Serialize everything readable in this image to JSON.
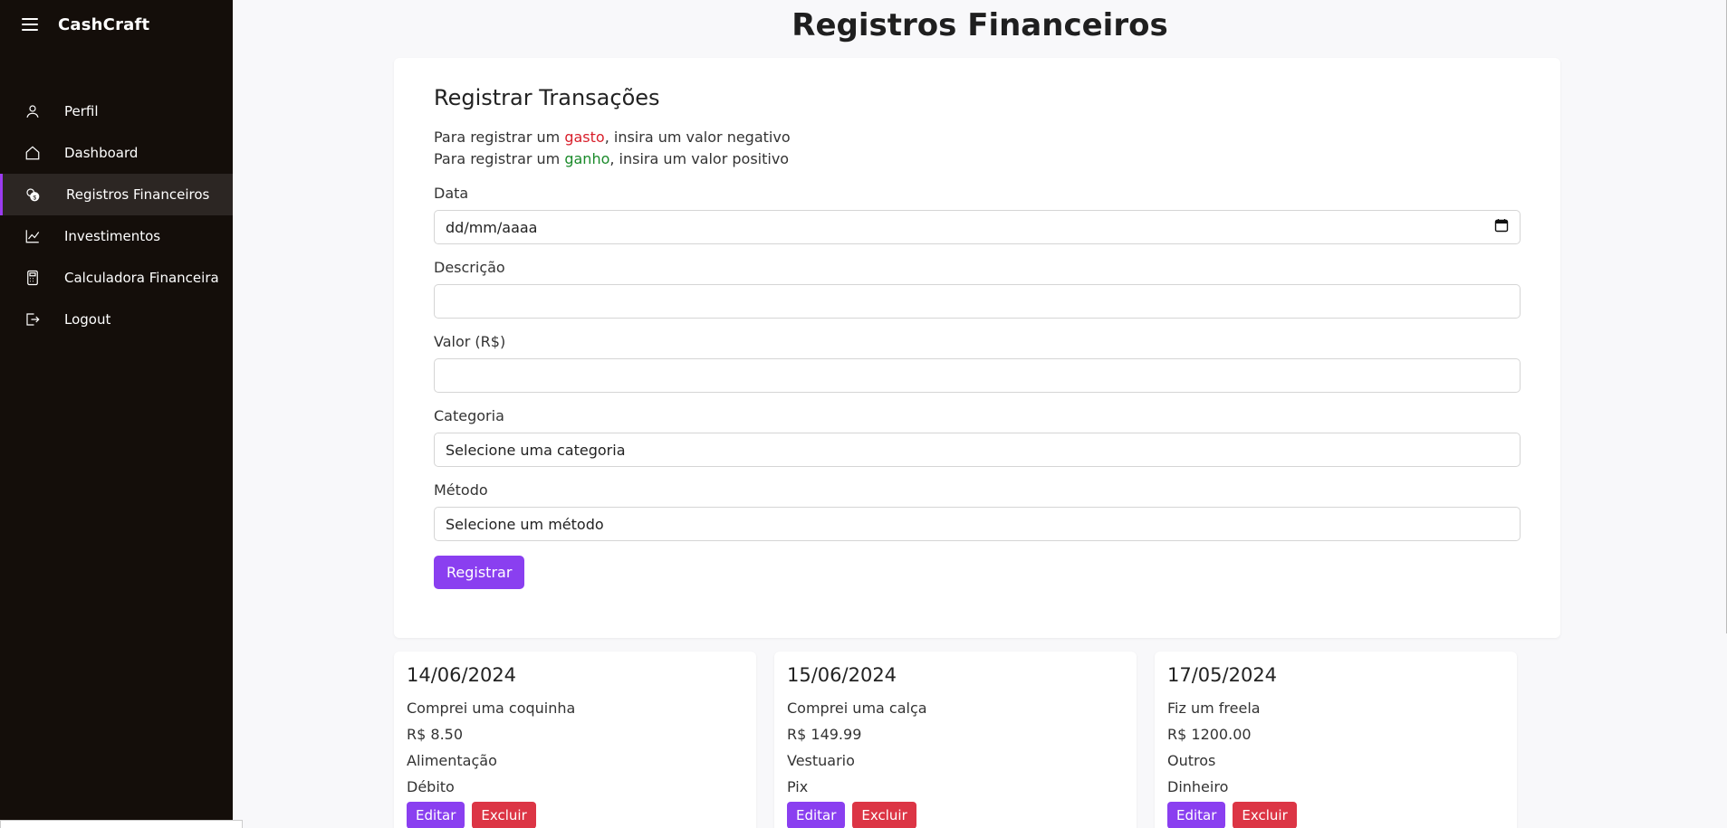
{
  "app": {
    "brand": "CashCraft"
  },
  "sidebar": {
    "items": [
      {
        "label": "Perfil",
        "icon": "user-icon"
      },
      {
        "label": "Dashboard",
        "icon": "home-icon"
      },
      {
        "label": "Registros Financeiros",
        "icon": "coins-icon",
        "active": true
      },
      {
        "label": "Investimentos",
        "icon": "chart-line-icon"
      },
      {
        "label": "Calculadora Financeira",
        "icon": "calculator-icon"
      },
      {
        "label": "Logout",
        "icon": "logout-icon"
      }
    ]
  },
  "page": {
    "title": "Registros Financeiros"
  },
  "form": {
    "title": "Registrar Transações",
    "hint1_prefix": "Para registrar um ",
    "hint1_word": "gasto",
    "hint1_suffix": ", insira um valor negativo",
    "hint2_prefix": "Para registrar um ",
    "hint2_word": "ganho",
    "hint2_suffix": ", insira um valor positivo",
    "date_label": "Data",
    "date_placeholder": "dd/mm/aaaa",
    "description_label": "Descrição",
    "description_value": "",
    "value_label": "Valor (R$)",
    "value_value": "",
    "category_label": "Categoria",
    "category_selected": "Selecione uma categoria",
    "method_label": "Método",
    "method_selected": "Selecione um método",
    "submit_label": "Registrar"
  },
  "transactions": [
    {
      "date": "14/06/2024",
      "description": "Comprei uma coquinha",
      "amount": "R$ 8.50",
      "type": "expense",
      "category": "Alimentação",
      "method": "Débito",
      "edit_label": "Editar",
      "delete_label": "Excluir"
    },
    {
      "date": "15/06/2024",
      "description": "Comprei uma calça",
      "amount": "R$ 149.99",
      "type": "expense",
      "category": "Vestuario",
      "method": "Pix",
      "edit_label": "Editar",
      "delete_label": "Excluir"
    },
    {
      "date": "17/05/2024",
      "description": "Fiz um freela",
      "amount": "R$ 1200.00",
      "type": "income",
      "category": "Outros",
      "method": "Dinheiro",
      "edit_label": "Editar",
      "delete_label": "Excluir"
    }
  ],
  "colors": {
    "accent": "#8a3ff0",
    "danger": "#dc3545",
    "expense": "#d81e2a",
    "income": "#1a8a2a",
    "sidebar_bg": "#140e0a"
  }
}
